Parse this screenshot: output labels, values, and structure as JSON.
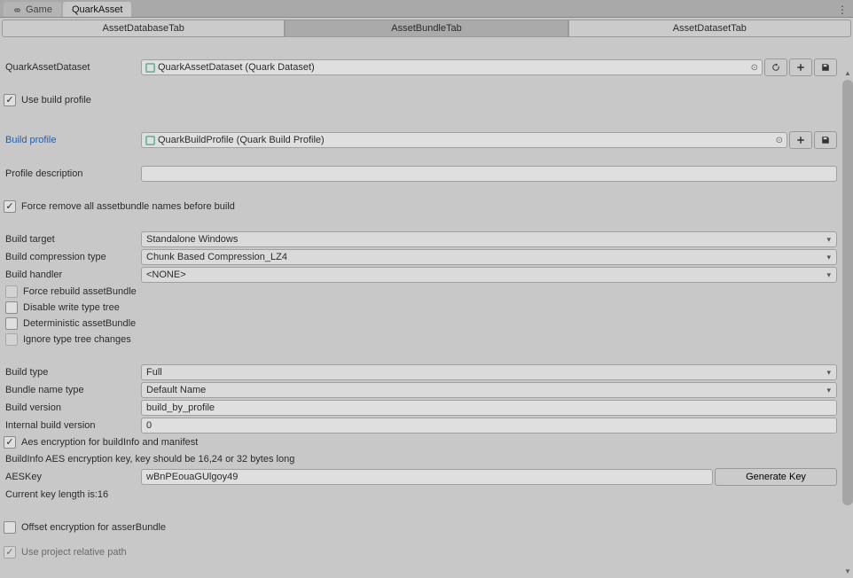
{
  "top_tabs": {
    "game": "Game",
    "quark_asset": "QuarkAsset"
  },
  "inner_tabs": {
    "database": "AssetDatabaseTab",
    "bundle": "AssetBundleTab",
    "dataset": "AssetDatasetTab"
  },
  "dataset_row": {
    "label": "QuarkAssetDataset",
    "value": "QuarkAssetDataset (Quark Dataset)"
  },
  "checkboxes": {
    "use_build_profile": "Use build profile",
    "force_remove_names": "Force remove all assetbundle names before build",
    "force_rebuild": "Force rebuild assetBundle",
    "disable_write_type_tree": "Disable write type tree",
    "deterministic": "Deterministic assetBundle",
    "ignore_type_tree": "Ignore type tree changes",
    "aes_encryption": "Aes encryption for buildInfo and manifest",
    "offset_encryption": "Offset encryption for asserBundle",
    "use_relative_path": "Use project relative path"
  },
  "profile": {
    "label": "Build profile",
    "value": "QuarkBuildProfile (Quark Build Profile)",
    "description_label": "Profile description",
    "description_value": ""
  },
  "build": {
    "target_label": "Build target",
    "target_value": "Standalone Windows",
    "compression_label": "Build compression type",
    "compression_value": "Chunk Based Compression_LZ4",
    "handler_label": "Build handler",
    "handler_value": "<NONE>",
    "type_label": "Build type",
    "type_value": "Full",
    "bundle_name_label": "Bundle name type",
    "bundle_name_value": "Default Name",
    "version_label": "Build version",
    "version_value": "build_by_profile",
    "internal_version_label": "Internal build version",
    "internal_version_value": "0"
  },
  "aes": {
    "hint": "BuildInfo AES encryption key, key should be 16,24 or 32 bytes long",
    "key_label": "AESKey",
    "key_value": "wBnPEouaGUlgoy49",
    "generate_label": "Generate Key",
    "length_text": "Current key length is:16"
  }
}
